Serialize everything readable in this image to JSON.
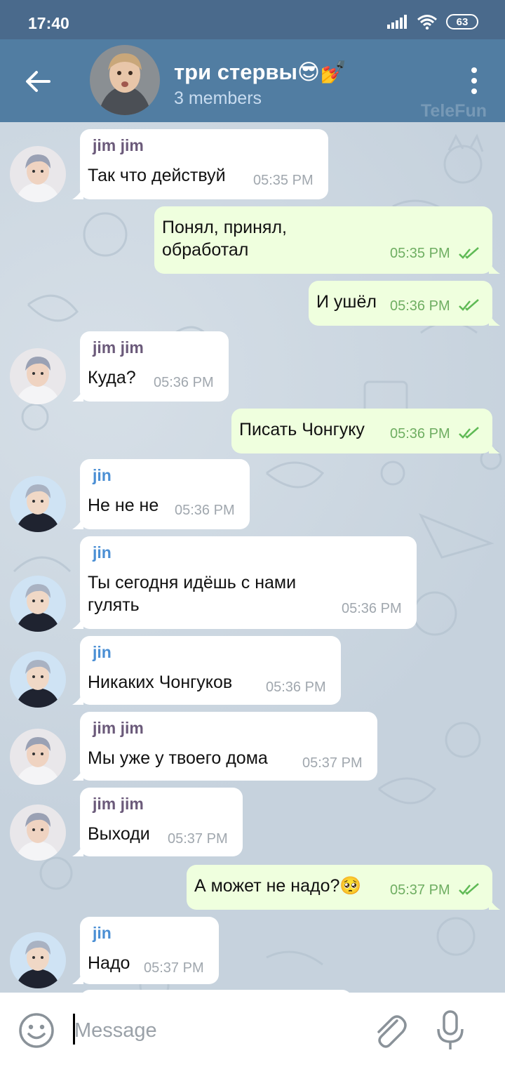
{
  "status": {
    "time": "17:40",
    "battery": "63"
  },
  "header": {
    "title": "три стервы😎💅",
    "subtitle": "3 members",
    "watermark": "TeleFun"
  },
  "messages": [
    {
      "type": "in",
      "sender": "jim jim",
      "text": "Так что действуй",
      "time": "05:35 PM"
    },
    {
      "type": "out",
      "text_lines": [
        "Понял, принял,",
        "обработал"
      ],
      "time": "05:35 PM"
    },
    {
      "type": "out",
      "text": "И ушёл",
      "time": "05:36 PM"
    },
    {
      "type": "in",
      "sender": "jim jim",
      "text": "Куда?",
      "time": "05:36 PM"
    },
    {
      "type": "out",
      "text": "Писать Чонгуку",
      "time": "05:36 PM"
    },
    {
      "type": "in",
      "sender": "jin",
      "text": "Не не не",
      "time": "05:36 PM"
    },
    {
      "type": "in",
      "sender": "jin",
      "text_lines": [
        "Ты сегодня идёшь с нами",
        "гулять"
      ],
      "time": "05:36 PM"
    },
    {
      "type": "in",
      "sender": "jin",
      "text": "Никаких Чонгуков",
      "time": "05:36 PM"
    },
    {
      "type": "in",
      "sender": "jim jim",
      "text": "Мы уже у твоего дома",
      "time": "05:37 PM"
    },
    {
      "type": "in",
      "sender": "jim jim",
      "text": "Выходи",
      "time": "05:37 PM"
    },
    {
      "type": "out",
      "text": "А может не надо?🥺",
      "time": "05:37 PM"
    },
    {
      "type": "in",
      "sender": "jin",
      "text": "Надо",
      "time": "05:37 PM"
    }
  ],
  "input": {
    "placeholder": "Message"
  },
  "colors": {
    "header": "#517da2",
    "status_bar": "#4a6a8c",
    "incoming_bubble": "#ffffff",
    "outgoing_bubble": "#efffde",
    "sender_jim": "#6b5a7a",
    "sender_jin": "#4b8fd4",
    "read_checks": "#5fba55"
  }
}
